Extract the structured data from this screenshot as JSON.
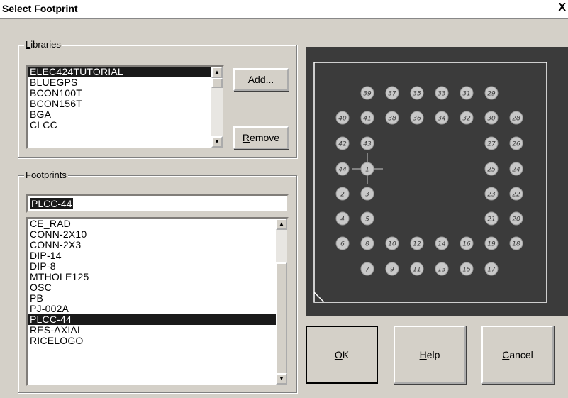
{
  "window": {
    "title": "Select Footprint",
    "close_label": "X"
  },
  "libraries": {
    "group_label_prefix": "",
    "group_label_mnemonic": "L",
    "group_label_rest": "ibraries",
    "items": [
      "ELEC424TUTORIAL",
      "BLUEGPS",
      "BCON100T",
      "BCON156T",
      "BGA",
      "CLCC"
    ],
    "selected_index": 0,
    "add_mnemonic": "A",
    "add_rest": "dd...",
    "remove_mnemonic": "R",
    "remove_rest": "emove"
  },
  "footprints": {
    "group_label_mnemonic": "F",
    "group_label_rest": "ootprints",
    "filter_value": "PLCC-44",
    "items": [
      "CE_RAD",
      "CONN-2X10",
      "CONN-2X3",
      "DIP-14",
      "DIP-8",
      "MTHOLE125",
      "OSC",
      "PB",
      "PJ-002A",
      "PLCC-44",
      "RES-AXIAL",
      "RICELOGO"
    ],
    "selected_index": 9
  },
  "buttons": {
    "ok_mnemonic": "O",
    "ok_rest": "K",
    "help_mnemonic": "H",
    "help_rest": "elp",
    "cancel_mnemonic": "C",
    "cancel_rest": "ancel"
  },
  "preview": {
    "background": "#3b3b3b",
    "outline": "#ffffff",
    "pad_color": "#c8c8c8",
    "pad_labels": {
      "top_row": [
        "39",
        "37",
        "35",
        "33",
        "31",
        "29"
      ],
      "row2": [
        "40",
        "41",
        "38",
        "36",
        "34",
        "32",
        "30",
        "28"
      ],
      "row3": [
        "42",
        "43",
        "27",
        "26"
      ],
      "row4": [
        "44",
        "1",
        "25",
        "24"
      ],
      "row5": [
        "2",
        "3",
        "23",
        "22"
      ],
      "row6": [
        "4",
        "5",
        "21",
        "20"
      ],
      "row7": [
        "6",
        "8",
        "10",
        "12",
        "14",
        "16",
        "19",
        "18"
      ],
      "bottom_row": [
        "7",
        "9",
        "11",
        "13",
        "15",
        "17"
      ]
    }
  }
}
